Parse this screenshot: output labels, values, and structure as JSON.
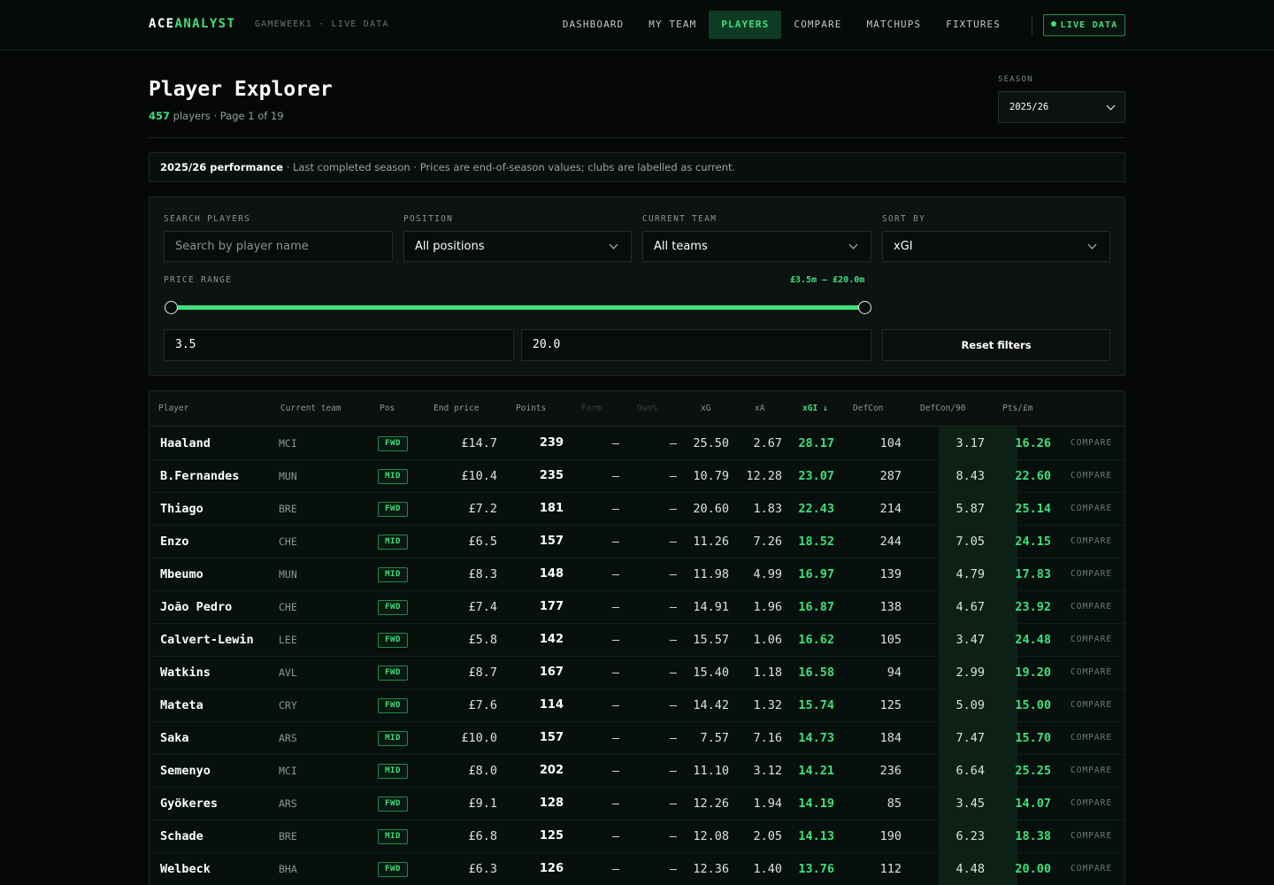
{
  "header": {
    "brand_a": "ACE",
    "brand_b": "ANALYST",
    "subtitle": "GAMEWEEK1 · LIVE DATA",
    "nav": [
      "DASHBOARD",
      "MY TEAM",
      "PLAYERS",
      "COMPARE",
      "MATCHUPS",
      "FIXTURES"
    ],
    "active_nav": "PLAYERS",
    "live_badge": "LIVE DATA"
  },
  "page": {
    "title": "Player Explorer",
    "count": "457",
    "meta_suffix": "players · Page 1 of 19",
    "season_label": "SEASON",
    "season_value": "2025/26"
  },
  "notice": {
    "bold": "2025/26 performance",
    "text": " · Last completed season · Prices are end-of-season values; clubs are labelled as current."
  },
  "filters": {
    "search_label": "SEARCH PLAYERS",
    "search_placeholder": "Search by player name",
    "position_label": "POSITION",
    "position_value": "All positions",
    "team_label": "CURRENT TEAM",
    "team_value": "All teams",
    "sort_label": "SORT BY",
    "sort_value": "xGI",
    "price_label": "PRICE RANGE",
    "price_display": "£3.5m – £20.0m",
    "price_min": "3.5",
    "price_max": "20.0",
    "reset_label": "Reset filters"
  },
  "table": {
    "columns": [
      "Player",
      "Current team",
      "Pos",
      "End price",
      "Points",
      "Form",
      "Own%",
      "xG",
      "xA",
      "xGI ↓",
      "DefCon",
      "DefCon/90",
      "Pts/£m"
    ],
    "compare_label": "COMPARE",
    "rows": [
      {
        "name": "Haaland",
        "team": "MCI",
        "pos": "FWD",
        "price": "£14.7",
        "points": "239",
        "form": "—",
        "own": "—",
        "xg": "25.50",
        "xa": "2.67",
        "xgi": "28.17",
        "defcon": "104",
        "defcon90": "3.17",
        "ptspm": "16.26"
      },
      {
        "name": "B.Fernandes",
        "team": "MUN",
        "pos": "MID",
        "price": "£10.4",
        "points": "235",
        "form": "—",
        "own": "—",
        "xg": "10.79",
        "xa": "12.28",
        "xgi": "23.07",
        "defcon": "287",
        "defcon90": "8.43",
        "ptspm": "22.60"
      },
      {
        "name": "Thiago",
        "team": "BRE",
        "pos": "FWD",
        "price": "£7.2",
        "points": "181",
        "form": "—",
        "own": "—",
        "xg": "20.60",
        "xa": "1.83",
        "xgi": "22.43",
        "defcon": "214",
        "defcon90": "5.87",
        "ptspm": "25.14"
      },
      {
        "name": "Enzo",
        "team": "CHE",
        "pos": "MID",
        "price": "£6.5",
        "points": "157",
        "form": "—",
        "own": "—",
        "xg": "11.26",
        "xa": "7.26",
        "xgi": "18.52",
        "defcon": "244",
        "defcon90": "7.05",
        "ptspm": "24.15"
      },
      {
        "name": "Mbeumo",
        "team": "MUN",
        "pos": "MID",
        "price": "£8.3",
        "points": "148",
        "form": "—",
        "own": "—",
        "xg": "11.98",
        "xa": "4.99",
        "xgi": "16.97",
        "defcon": "139",
        "defcon90": "4.79",
        "ptspm": "17.83"
      },
      {
        "name": "João Pedro",
        "team": "CHE",
        "pos": "FWD",
        "price": "£7.4",
        "points": "177",
        "form": "—",
        "own": "—",
        "xg": "14.91",
        "xa": "1.96",
        "xgi": "16.87",
        "defcon": "138",
        "defcon90": "4.67",
        "ptspm": "23.92"
      },
      {
        "name": "Calvert-Lewin",
        "team": "LEE",
        "pos": "FWD",
        "price": "£5.8",
        "points": "142",
        "form": "—",
        "own": "—",
        "xg": "15.57",
        "xa": "1.06",
        "xgi": "16.62",
        "defcon": "105",
        "defcon90": "3.47",
        "ptspm": "24.48"
      },
      {
        "name": "Watkins",
        "team": "AVL",
        "pos": "FWD",
        "price": "£8.7",
        "points": "167",
        "form": "—",
        "own": "—",
        "xg": "15.40",
        "xa": "1.18",
        "xgi": "16.58",
        "defcon": "94",
        "defcon90": "2.99",
        "ptspm": "19.20"
      },
      {
        "name": "Mateta",
        "team": "CRY",
        "pos": "FWD",
        "price": "£7.6",
        "points": "114",
        "form": "—",
        "own": "—",
        "xg": "14.42",
        "xa": "1.32",
        "xgi": "15.74",
        "defcon": "125",
        "defcon90": "5.09",
        "ptspm": "15.00"
      },
      {
        "name": "Saka",
        "team": "ARS",
        "pos": "MID",
        "price": "£10.0",
        "points": "157",
        "form": "—",
        "own": "—",
        "xg": "7.57",
        "xa": "7.16",
        "xgi": "14.73",
        "defcon": "184",
        "defcon90": "7.47",
        "ptspm": "15.70"
      },
      {
        "name": "Semenyo",
        "team": "MCI",
        "pos": "MID",
        "price": "£8.0",
        "points": "202",
        "form": "—",
        "own": "—",
        "xg": "11.10",
        "xa": "3.12",
        "xgi": "14.21",
        "defcon": "236",
        "defcon90": "6.64",
        "ptspm": "25.25"
      },
      {
        "name": "Gyökeres",
        "team": "ARS",
        "pos": "FWD",
        "price": "£9.1",
        "points": "128",
        "form": "—",
        "own": "—",
        "xg": "12.26",
        "xa": "1.94",
        "xgi": "14.19",
        "defcon": "85",
        "defcon90": "3.45",
        "ptspm": "14.07"
      },
      {
        "name": "Schade",
        "team": "BRE",
        "pos": "MID",
        "price": "£6.8",
        "points": "125",
        "form": "—",
        "own": "—",
        "xg": "12.08",
        "xa": "2.05",
        "xgi": "14.13",
        "defcon": "190",
        "defcon90": "6.23",
        "ptspm": "18.38"
      },
      {
        "name": "Welbeck",
        "team": "BHA",
        "pos": "FWD",
        "price": "£6.3",
        "points": "126",
        "form": "—",
        "own": "—",
        "xg": "12.36",
        "xa": "1.40",
        "xgi": "13.76",
        "defcon": "112",
        "defcon90": "4.48",
        "ptspm": "20.00"
      }
    ]
  }
}
